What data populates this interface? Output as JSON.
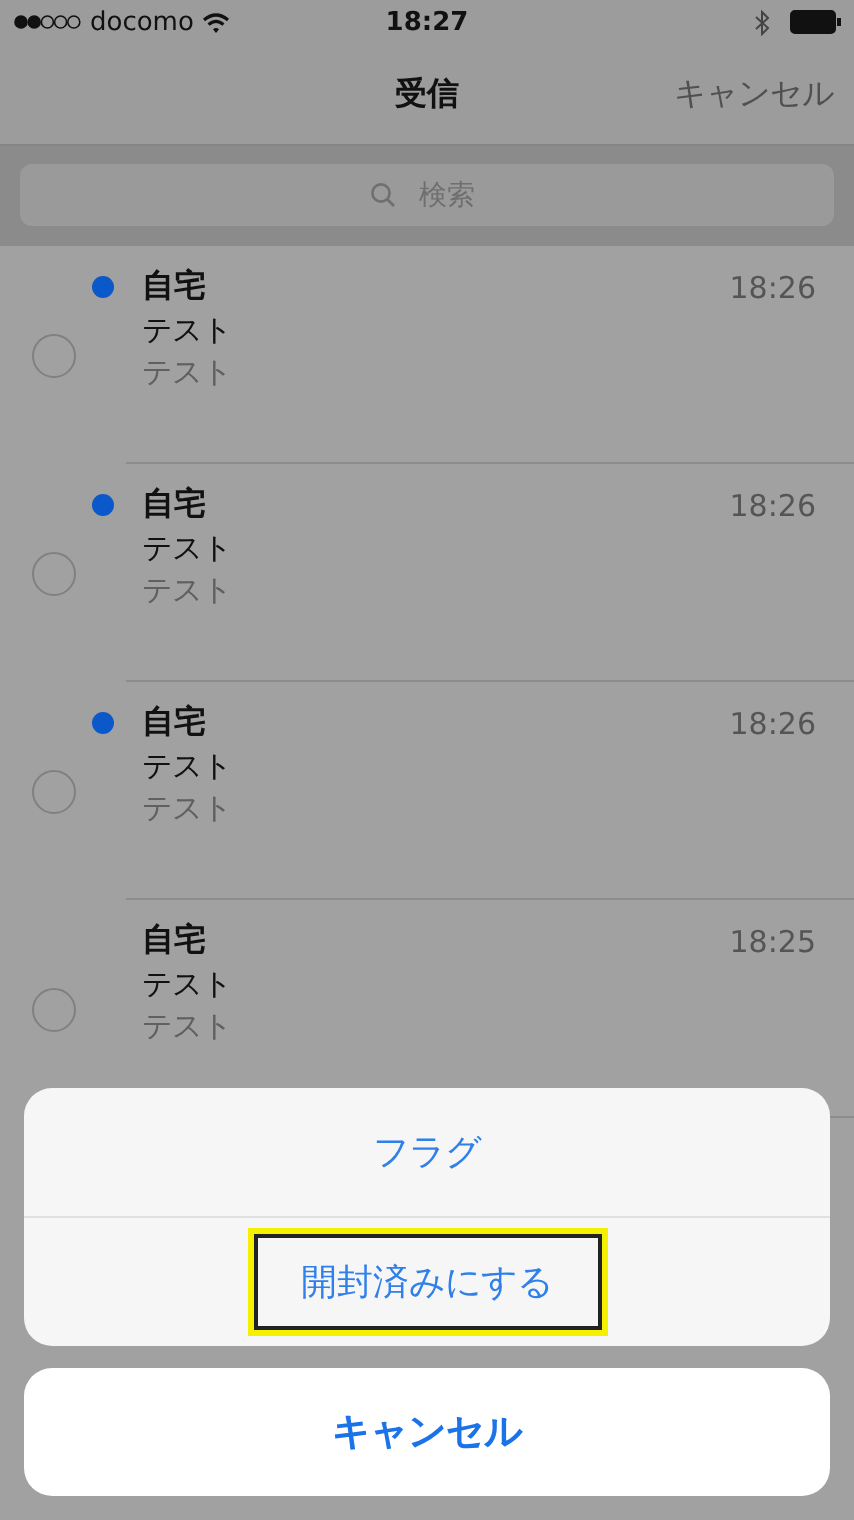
{
  "status_bar": {
    "carrier": "docomo",
    "time": "18:27"
  },
  "nav_bar": {
    "title": "受信",
    "right_button": "キャンセル"
  },
  "search": {
    "placeholder": "検索"
  },
  "messages": [
    {
      "sender": "自宅",
      "subject": "テスト",
      "preview": "テスト",
      "time": "18:26",
      "unread": true
    },
    {
      "sender": "自宅",
      "subject": "テスト",
      "preview": "テスト",
      "time": "18:26",
      "unread": true
    },
    {
      "sender": "自宅",
      "subject": "テスト",
      "preview": "テスト",
      "time": "18:26",
      "unread": true
    },
    {
      "sender": "自宅",
      "subject": "テスト",
      "preview": "テスト",
      "time": "18:25",
      "unread": false
    }
  ],
  "action_sheet": {
    "actions": [
      {
        "label": "フラグ",
        "highlighted": false
      },
      {
        "label": "開封済みにする",
        "highlighted": true
      }
    ],
    "cancel": "キャンセル"
  }
}
